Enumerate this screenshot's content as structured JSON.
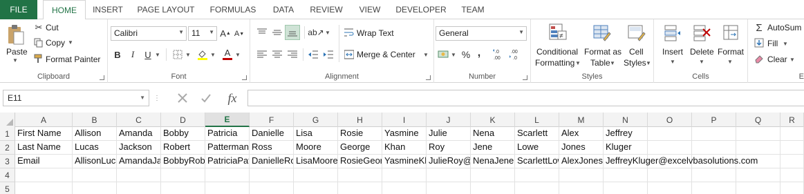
{
  "tabs": [
    "FILE",
    "HOME",
    "INSERT",
    "PAGE LAYOUT",
    "FORMULAS",
    "DATA",
    "REVIEW",
    "VIEW",
    "DEVELOPER",
    "TEAM"
  ],
  "active_tab": "HOME",
  "ribbon": {
    "clipboard": {
      "paste": "Paste",
      "cut": "Cut",
      "copy": "Copy",
      "format_painter": "Format Painter",
      "label": "Clipboard"
    },
    "font": {
      "name": "Calibri",
      "size": "11",
      "bold": "B",
      "italic": "I",
      "underline": "U",
      "label": "Font"
    },
    "alignment": {
      "wrap_text": "Wrap Text",
      "merge_center": "Merge & Center",
      "label": "Alignment"
    },
    "number": {
      "format": "General",
      "percent": "%",
      "comma": ",",
      "label": "Number"
    },
    "styles": {
      "conditional": "Conditional",
      "conditional2": "Formatting",
      "format_as": "Format as",
      "format_as2": "Table",
      "cell_styles": "Cell",
      "cell_styles2": "Styles",
      "label": "Styles"
    },
    "cells": {
      "insert": "Insert",
      "delete": "Delete",
      "format": "Format",
      "label": "Cells"
    },
    "editing": {
      "autosum": "AutoSum",
      "fill": "Fill",
      "clear": "Clear",
      "label": "E"
    }
  },
  "formula_bar": {
    "name_box": "E11",
    "fx": "fx",
    "formula": ""
  },
  "grid": {
    "active_column": "E",
    "columns": [
      "A",
      "B",
      "C",
      "D",
      "E",
      "F",
      "G",
      "H",
      "I",
      "J",
      "K",
      "L",
      "M",
      "N",
      "O",
      "P",
      "Q",
      "R"
    ],
    "row_numbers": [
      "1",
      "2",
      "3",
      "4",
      "5"
    ],
    "rows": [
      [
        "First Name",
        "Allison",
        "Amanda",
        "Bobby",
        "Patricia",
        "Danielle",
        "Lisa",
        "Rosie",
        "Yasmine",
        "Julie",
        "Nena",
        "Scarlett",
        "Alex",
        "Jeffrey"
      ],
      [
        "Last Name",
        "Lucas",
        "Jackson",
        "Robert",
        "Patterman",
        "Ross",
        "Moore",
        "George",
        "Khan",
        "Roy",
        "Jene",
        "Lowe",
        "Jones",
        "Kluger"
      ],
      [
        "Email",
        "AllisonLucas@excelvbasolutions.com",
        "AmandaJackson@excelvbasolutions.com",
        "BobbyRobert@excelvbasolutions.com",
        "PatriciaPatterman@excelvbasolutions.com",
        "DanielleRoss@excelvbasolutions.com",
        "LisaMoore@excelvbasolutions.com",
        "RosieGeorge@excelvbasolutions.com",
        "YasmineKhan@excelvbasolutions.com",
        "JulieRoy@excelvbasolutions.com",
        "NenaJene@excelvbasolutions.com",
        "ScarlettLowe@excelvbasolutions.com",
        "AlexJones@excelvbasolutions.com",
        "JeffreyKluger@excelvbasolutions.com"
      ],
      [],
      []
    ]
  }
}
